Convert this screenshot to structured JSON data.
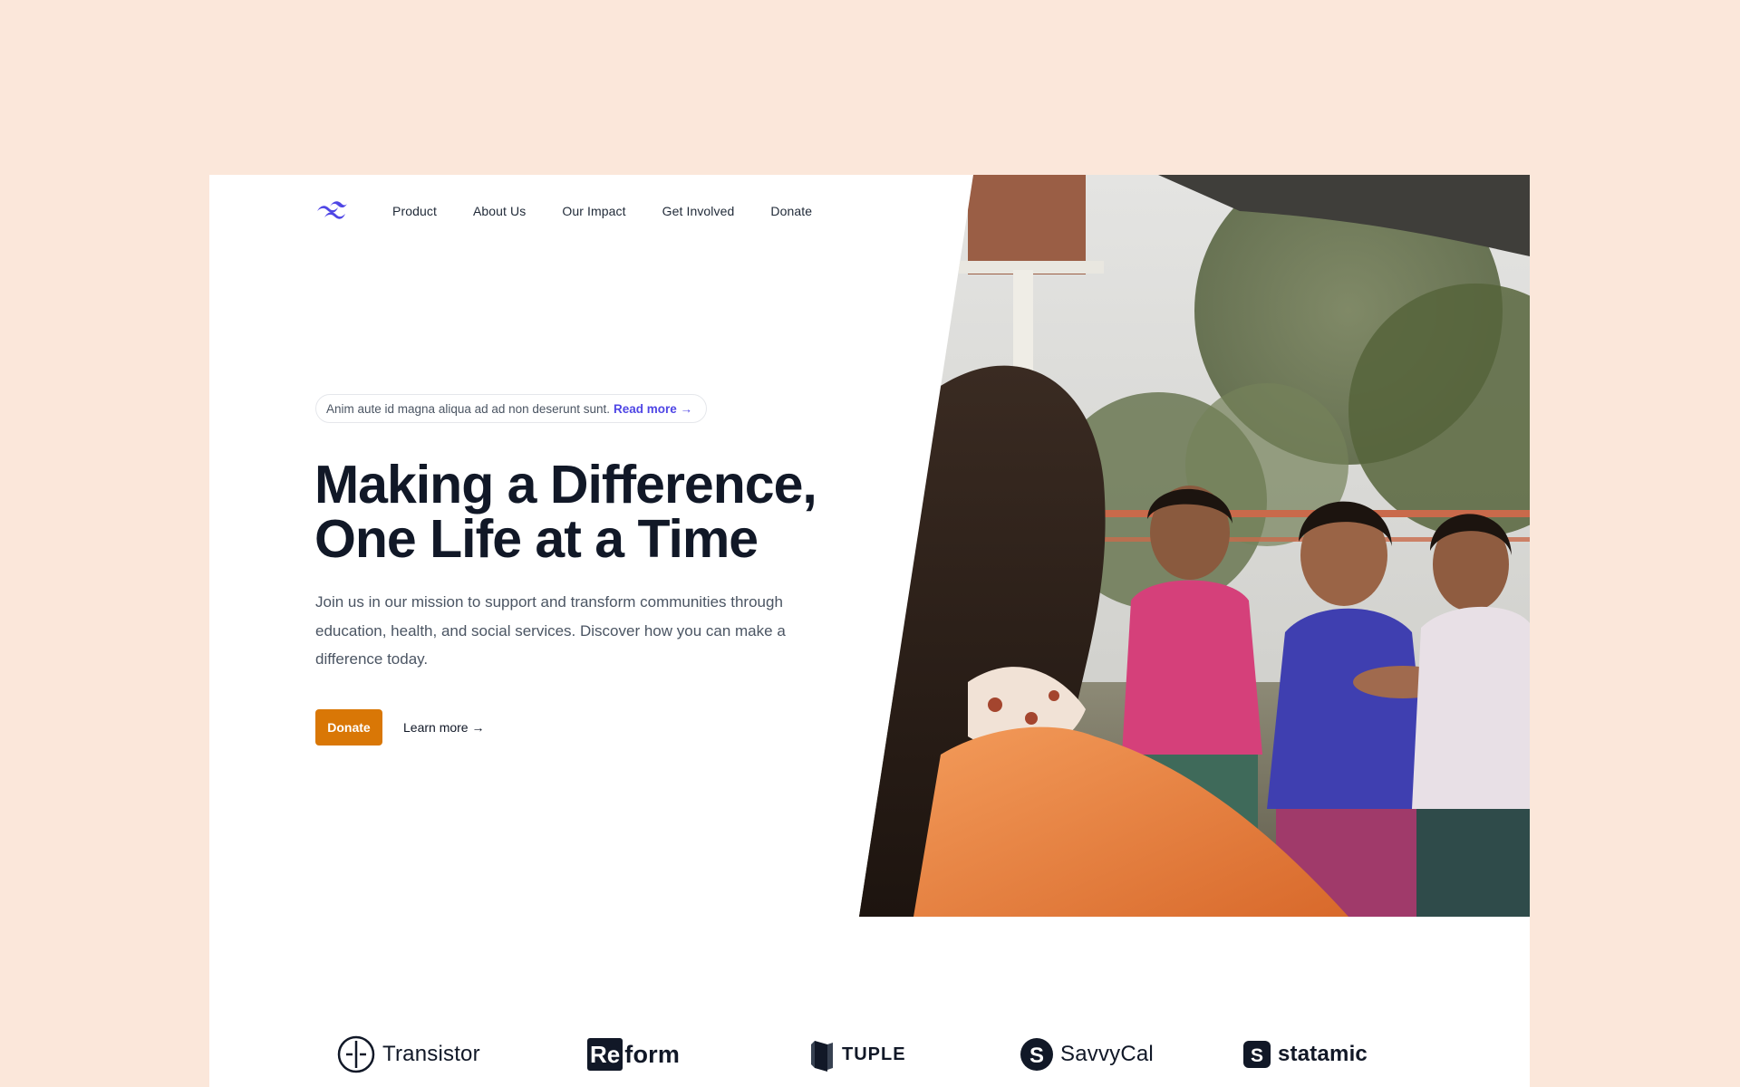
{
  "nav": {
    "logo_icon": "tailwind-wave-logo",
    "items": [
      {
        "label": "Product"
      },
      {
        "label": "About Us"
      },
      {
        "label": "Our Impact"
      },
      {
        "label": "Get Involved"
      },
      {
        "label": "Donate"
      }
    ]
  },
  "announcement": {
    "text": "Anim aute id magna aliqua ad ad non deserunt sunt.",
    "link_label": "Read more →"
  },
  "hero": {
    "title_line_1": "Making a Difference,",
    "title_line_2": "One Life at a Time",
    "description": "Join us in our mission to support and transform communities through education, health, and social services. Discover how you can make a difference today.",
    "primary_cta": "Donate",
    "secondary_cta": "Learn more →",
    "image_description_icon": "children-photo"
  },
  "logos": [
    {
      "name": "Transistor",
      "icon": "transistor-logo"
    },
    {
      "name_a": "Re",
      "name_b": "form",
      "icon": "reform-logo"
    },
    {
      "name": "TUPLE",
      "icon": "tuple-logo"
    },
    {
      "name": "SavvyCal",
      "icon": "savvycal-logo"
    },
    {
      "name": "statamic",
      "icon": "statamic-logo"
    }
  ],
  "colors": {
    "page_background": "#fbe7da",
    "accent": "#d97706",
    "link": "#4f46e5",
    "logo": "#4f46e5",
    "heading": "#111827"
  }
}
